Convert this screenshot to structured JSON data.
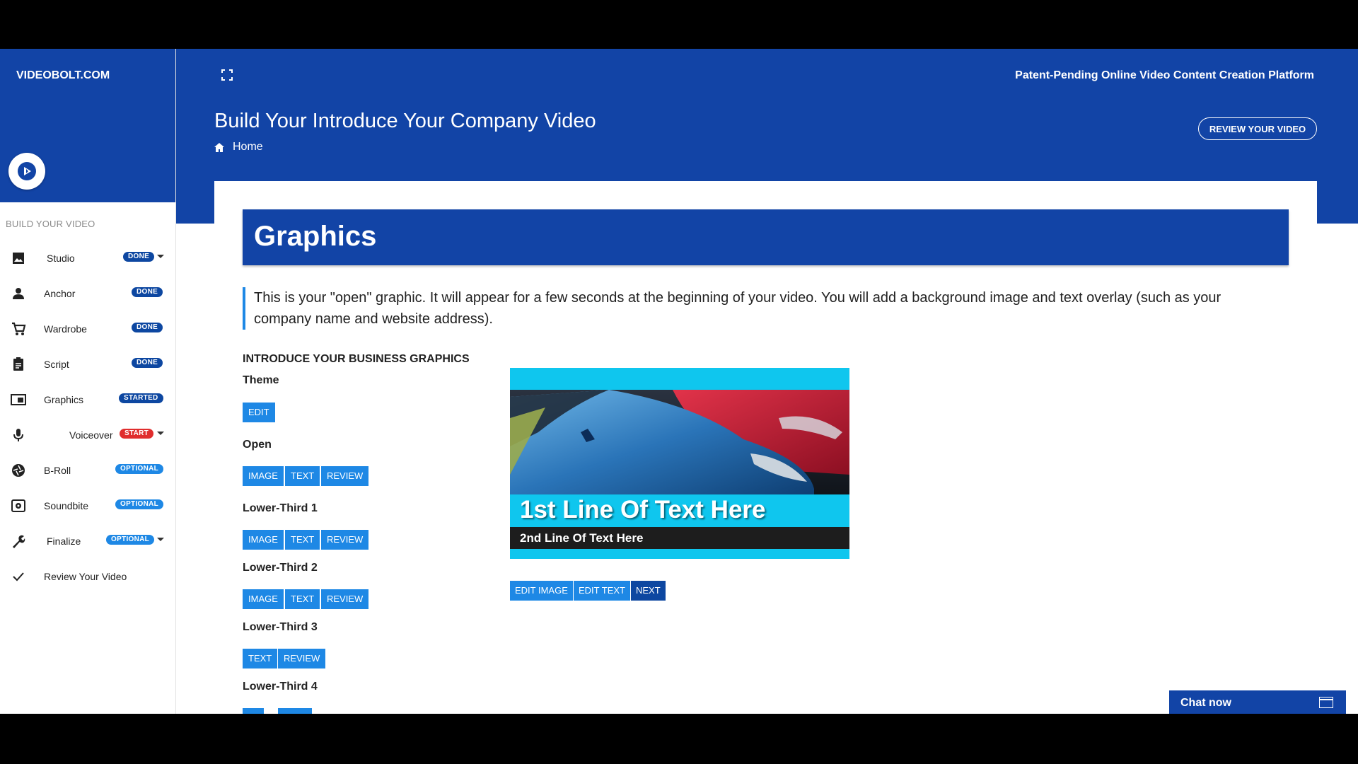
{
  "brand": "VIDEOBOLT.COM",
  "tagline": "Patent-Pending Online Video Content Creation Platform",
  "page_title": "Build Your Introduce Your Company Video",
  "breadcrumb": {
    "home_label": "Home"
  },
  "review_button": "REVIEW YOUR VIDEO",
  "sidebar": {
    "section_title": "BUILD YOUR VIDEO",
    "items": [
      {
        "label": "Studio",
        "badge": "DONE",
        "icon": "image-icon",
        "caret": true
      },
      {
        "label": "Anchor",
        "badge": "DONE",
        "icon": "person-icon"
      },
      {
        "label": "Wardrobe",
        "badge": "DONE",
        "icon": "cart-icon"
      },
      {
        "label": "Script",
        "badge": "DONE",
        "icon": "clipboard-icon"
      },
      {
        "label": "Graphics",
        "badge": "STARTED",
        "icon": "graphics-icon"
      },
      {
        "label": "Voiceover",
        "badge": "START",
        "icon": "mic-icon",
        "caret": true
      },
      {
        "label": "B-Roll",
        "badge": "OPTIONAL",
        "icon": "aperture-icon"
      },
      {
        "label": "Soundbite",
        "badge": "OPTIONAL",
        "icon": "speaker-icon"
      },
      {
        "label": "Finalize",
        "badge": "OPTIONAL",
        "icon": "wrench-icon",
        "caret": true
      },
      {
        "label": "Review Your Video",
        "icon": "check-icon"
      }
    ]
  },
  "graphics": {
    "header": "Graphics",
    "intro": "This is your \"open\" graphic. It will appear for a few seconds at the beginning of your video. You will add a background image and text overlay (such as your company name and website address).",
    "section_title": "INTRODUCE YOUR BUSINESS GRAPHICS",
    "theme_label": "Theme",
    "edit_label": "EDIT",
    "open_label": "Open",
    "lower1_label": "Lower-Third 1",
    "lower2_label": "Lower-Third 2",
    "lower3_label": "Lower-Third 3",
    "lower4_label": "Lower-Third 4",
    "image_label": "IMAGE",
    "text_label": "TEXT",
    "review_label": "REVIEW"
  },
  "preview": {
    "line1": "1st Line Of Text Here",
    "line2": "2nd Line Of Text Here",
    "edit_image": "EDIT IMAGE",
    "edit_text": "EDIT TEXT",
    "next": "NEXT"
  },
  "chat": {
    "label": "Chat now"
  },
  "colors": {
    "brand_blue": "#1244a6",
    "button_blue": "#1e88e5",
    "dark_blue": "#0d47a1",
    "start_red": "#e02d2d",
    "preview_cyan": "#0fc6ee"
  }
}
